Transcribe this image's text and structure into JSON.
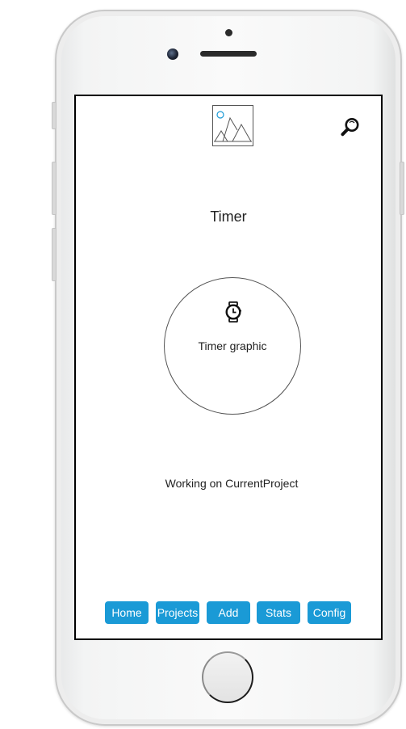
{
  "header": {
    "logo_icon": "image-placeholder-icon",
    "search_icon": "magnifier-icon"
  },
  "main": {
    "title": "Timer",
    "timer_icon": "watch-icon",
    "timer_label": "Timer graphic",
    "status": "Working on CurrentProject"
  },
  "nav": {
    "items": [
      {
        "label": "Home"
      },
      {
        "label": "Projects"
      },
      {
        "label": "Add"
      },
      {
        "label": "Stats"
      },
      {
        "label": "Config"
      }
    ]
  },
  "colors": {
    "accent": "#1a9ad6",
    "text": "#222222"
  }
}
